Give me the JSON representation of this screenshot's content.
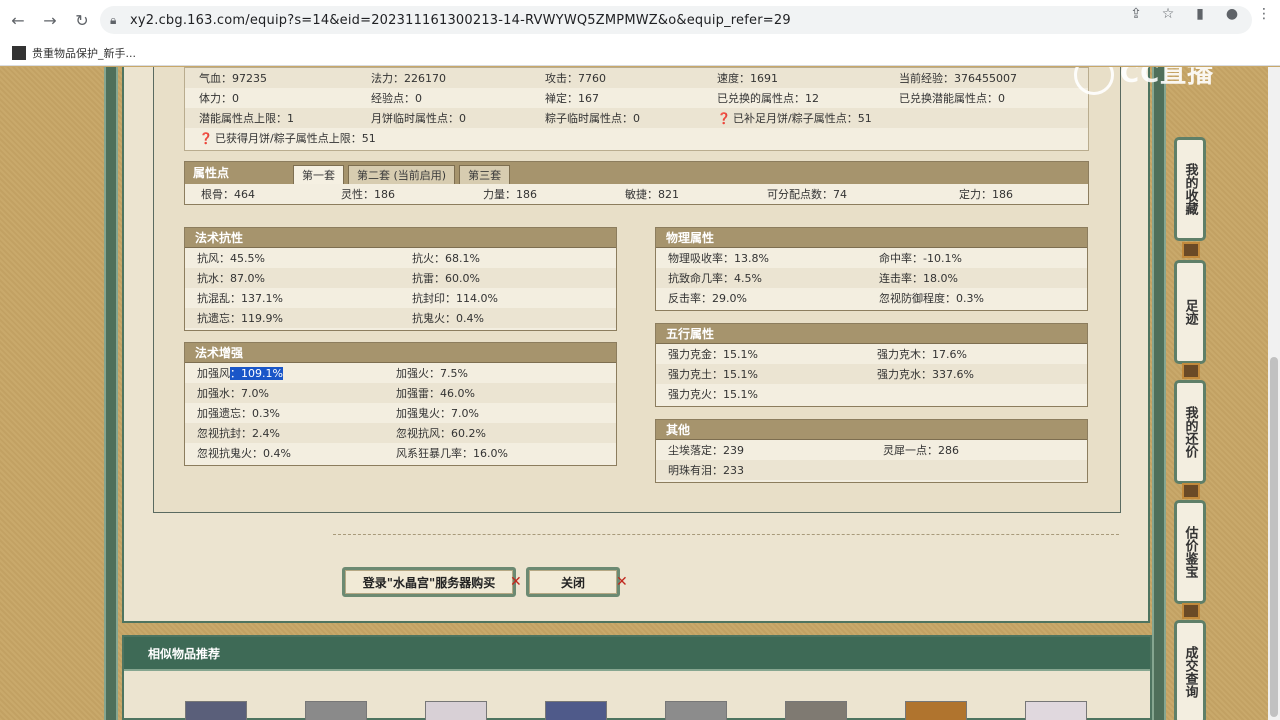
{
  "browser": {
    "url": "xy2.cbg.163.com/equip?s=14&eid=202311161300213-14-RVWYWQ5ZMPMWZ&o&equip_refer=29",
    "bookmark": "贵重物品保护_新手...",
    "watermark": "CC直播"
  },
  "info": {
    "r1": [
      "气血：97235",
      "法力：226170",
      "攻击：7760",
      "速度：1691",
      "当前经验：376455007"
    ],
    "r2": [
      "体力：0",
      "经验点：0",
      "禅定：167",
      "已兑换的属性点：12",
      "已兑换潜能属性点：0"
    ],
    "r3": [
      "潜能属性点上限：1",
      "月饼临时属性点：0",
      "粽子临时属性点：0",
      "已补足月饼/粽子属性点：51"
    ],
    "r4": [
      "已获得月饼/粽子属性点上限：51"
    ]
  },
  "attr": {
    "title": "属性点",
    "tabs": [
      "第一套",
      "第二套 (当前启用)",
      "第三套"
    ],
    "values": [
      "根骨：464",
      "灵性：186",
      "力量：186",
      "敏捷：821",
      "可分配点数：74",
      "定力：186"
    ]
  },
  "resist": {
    "title": "法术抗性",
    "rows": [
      [
        "抗风：45.5%",
        "抗火：68.1%"
      ],
      [
        "抗水：87.0%",
        "抗雷：60.0%"
      ],
      [
        "抗混乱：137.1%",
        "抗封印：114.0%"
      ],
      [
        "抗遗忘：119.9%",
        "抗鬼火：0.4%"
      ]
    ]
  },
  "enhance": {
    "title": "法术增强",
    "first_label": "加强风",
    "first_value": "：109.1%",
    "rows": [
      [
        "加强火：7.5%"
      ],
      [
        "加强水：7.0%",
        "加强雷：46.0%"
      ],
      [
        "加强遗忘：0.3%",
        "加强鬼火：7.0%"
      ],
      [
        "忽视抗封：2.4%",
        "忽视抗风：60.2%"
      ],
      [
        "忽视抗鬼火：0.4%",
        "风系狂暴几率：16.0%"
      ]
    ]
  },
  "physical": {
    "title": "物理属性",
    "rows": [
      [
        "物理吸收率：13.8%",
        "命中率：-10.1%"
      ],
      [
        "抗致命几率：4.5%",
        "连击率：18.0%"
      ],
      [
        "反击率：29.0%",
        "忽视防御程度：0.3%"
      ]
    ]
  },
  "elements": {
    "title": "五行属性",
    "rows": [
      [
        "强力克金：15.1%",
        "强力克木：17.6%"
      ],
      [
        "强力克土：15.1%",
        "强力克水：337.6%"
      ],
      [
        "强力克火：15.1%"
      ]
    ]
  },
  "other": {
    "title": "其他",
    "rows": [
      [
        "尘埃落定：239",
        "灵犀一点：286"
      ],
      [
        "明珠有泪：233"
      ]
    ]
  },
  "buttons": {
    "buy": "登录\"水晶宫\"服务器购买",
    "close": "关闭"
  },
  "similar": {
    "title": "相似物品推荐"
  },
  "side": {
    "fav": "我的收藏",
    "track": "足迹",
    "bargain": "我的还价",
    "estimate": "估价鉴宝",
    "deals": "成交查询"
  }
}
